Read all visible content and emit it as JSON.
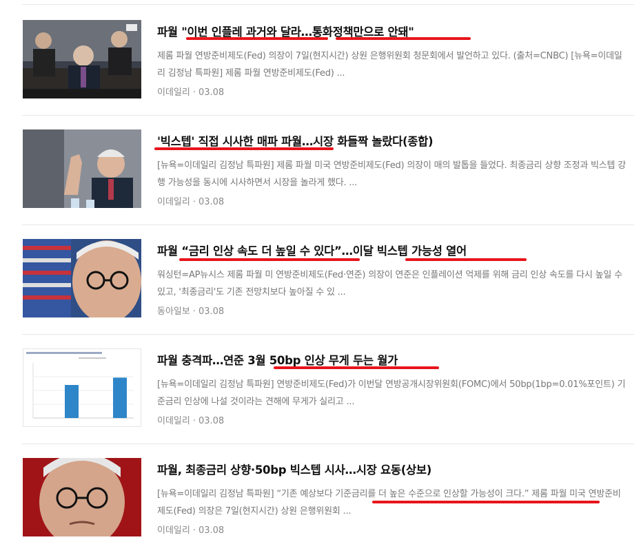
{
  "articles": [
    {
      "title": "파월 \"이번 인플레 과거와 달라…통화정책만으로 안돼\"",
      "desc": "제롬 파월 연방준비제도(Fed) 의장이 7일(현지시간) 상원 은행위원회 청문회에서 발언하고 있다. (출처=CNBC) [뉴욕=이데일리 김정남 특파원] 제롬 파월 연방준비제도(Fed) ...",
      "source": "이데일리",
      "sep": "·",
      "date": "03.08"
    },
    {
      "title": "'빅스텝' 직접 시사한 매파 파월…시장 화들짝 놀랐다(종합)",
      "desc": "[뉴욕=이데일리 김정남 특파원] 제롬 파월 미국 연방준비제도(Fed) 의장이 매의 발톱을 들었다. 최종금리 상향 조정과 빅스텝 강행 가능성을 동시에 시사하면서 시장을 놀라게 했다. ...",
      "source": "이데일리",
      "sep": "·",
      "date": "03.08"
    },
    {
      "title": "파월 “금리 인상 속도 더 높일 수 있다”…이달 빅스텝 가능성 열어",
      "desc": "워싱턴=AP뉴시스 제롬 파월 미 연방준비제도(Fed·연준) 의장이 연준은 인플레이션 억제를 위해 금리 인상 속도를 다시 높일 수 있고, '최종금리'도 기존 전망치보다 높아질 수 있 ...",
      "source": "동아일보",
      "sep": "·",
      "date": "03.08"
    },
    {
      "title": "파월 충격파…연준 3월 50bp 인상 무게 두는 월가",
      "desc": "[뉴욕=이데일리 김정남 특파원] 연방준비제도(Fed)가 이번달 연방공개시장위원회(FOMC)에서 50bp(1bp=0.01%포인트) 기준금리 인상에 나설 것이라는 견해에 무게가 실리고 ...",
      "source": "이데일리",
      "sep": "·",
      "date": "03.08"
    },
    {
      "title": "파월, 최종금리 상향·50bp 빅스텝 시사…시장 요동(상보)",
      "desc": "[뉴욕=이데일리 김정남 특파원] “기존 예상보다 기준금리를 더 높은 수준으로 인상할 가능성이 크다.” 제롬 파월 미국 연방준비제도(Fed) 의장은 7일(현지시간) 상원 은행위원회 ...",
      "source": "이데일리",
      "sep": "·",
      "date": "03.08"
    }
  ],
  "thumb_chart": {
    "values": [
      36,
      44
    ]
  },
  "colors": {
    "highlight": "#e8141b",
    "meta": "#888888",
    "title": "#111111"
  }
}
